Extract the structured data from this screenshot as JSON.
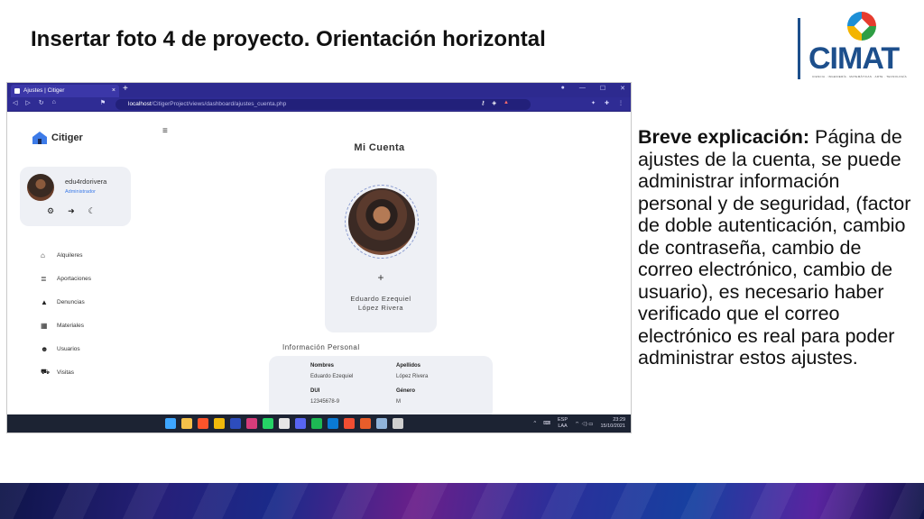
{
  "slide": {
    "title": "Insertar foto 4 de proyecto. Orientación horizontal",
    "logo_text": "CIMAT",
    "logo_sub": "CIENCIA · INGENIERÍA · MATEMÁTICAS · ARTE · TECNOLOGÍA",
    "explanation_lead": "Breve explicación:",
    "explanation_body": " Página de ajustes de la cuenta, se puede administrar información personal y de seguridad, (factor de doble autenticación, cambio de contraseña, cambio de correo electrónico, cambio de usuario), es necesario haber verificado que el correo electrónico es real para poder administrar estos ajustes."
  },
  "browser": {
    "tab_title": "Ajustes | Citiger",
    "tab_close": "×",
    "new_tab": "+",
    "url_host": "localhost",
    "url_path": "/CitigerProject/views/dashboard/ajustes_cuenta.php"
  },
  "app": {
    "brand": "Citiger",
    "username": "edu4rdorivera",
    "role": "Administrador",
    "menu": [
      {
        "label": "Alquileres",
        "icon": "home-icon"
      },
      {
        "label": "Aportaciones",
        "icon": "coins-icon"
      },
      {
        "label": "Denuncias",
        "icon": "warning-icon"
      },
      {
        "label": "Materiales",
        "icon": "boxes-icon"
      },
      {
        "label": "Usuarios",
        "icon": "users-icon"
      },
      {
        "label": "Visitas",
        "icon": "car-icon"
      }
    ],
    "section_title": "Mi Cuenta",
    "plus": "+",
    "full_name_line1": "Eduardo Ezequiel",
    "full_name_line2": "López Rivera",
    "info_title": "Información Personal",
    "fields": {
      "nombres_label": "Nombres",
      "nombres_value": "Eduardo Ezequiel",
      "apellidos_label": "Apellidos",
      "apellidos_value": "López Rivera",
      "dui_label": "DUI",
      "dui_value": "12345678-9",
      "genero_label": "Género",
      "genero_value": "M"
    }
  },
  "taskbar": {
    "lang_line1": "ESP",
    "lang_line2": "LAA",
    "time": "23:29",
    "date": "15/10/2021"
  },
  "colors": {
    "browser_chrome": "#2d2a8f",
    "accent_blue": "#3d7be8",
    "card_bg": "#eef0f5",
    "cimat_blue": "#1d4f8c"
  }
}
